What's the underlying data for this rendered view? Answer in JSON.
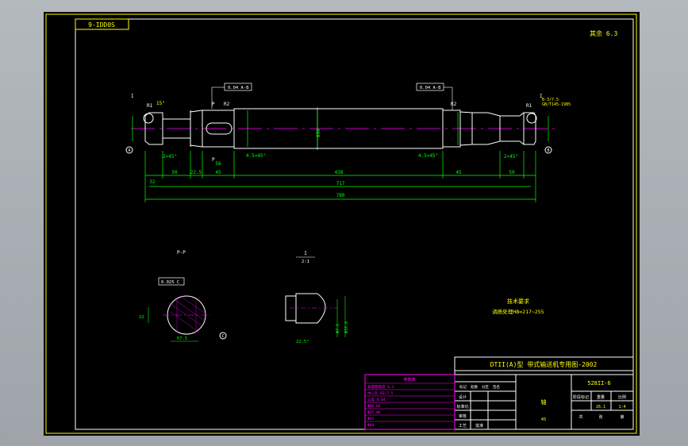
{
  "colors": {
    "background": "#000000",
    "frame": "#ffff00",
    "outline": "#ffffff",
    "dimension": "#00ff00",
    "centerline": "#ff00ff",
    "annotation": "#ffff00",
    "table": "#ff00ff"
  },
  "drawing_code_box": "9-IDD0S",
  "surface_finish_mark": "其余 6.3",
  "shaft": {
    "overall_length": "780",
    "length_717": "717",
    "length_438": "438",
    "left_segments": [
      "32",
      "50",
      "22.5",
      "45",
      "56"
    ],
    "right_segments": [
      "45",
      "50"
    ],
    "chamfer_left": "2×45°",
    "chamfer_mid_left": "4.5×45°",
    "chamfer_mid_right": "4.5×45°",
    "chamfer_right": "2×45°",
    "tolerance_left": "0.04 A-B",
    "tolerance_right": "0.04 A-B",
    "datum_a": "A",
    "datum_b": "B",
    "section_p_left": "P",
    "section_p_right": "P",
    "detail_label": "I",
    "radius_r1": "R1",
    "radius_r2": "R2",
    "center_hole_note": "B-3/7.5",
    "center_hole_std": "GB/T145-1985",
    "diameter_main": "Φ90",
    "angle_note": "15°"
  },
  "section_view": {
    "label": "P-P",
    "tolerance": "0.025 C",
    "key_width": "22",
    "dim_depth": "67.5",
    "datum_c": "C"
  },
  "detail_view": {
    "label_top": "I",
    "label_scale": "2:1",
    "angle": "22.5°",
    "dim_a": "Φ7.5",
    "dim_b": "Φ16.4"
  },
  "tech_requirements": {
    "title": "技术要求",
    "line1": "调质处理HB=217~255"
  },
  "title_block": {
    "series_title": "DTII(A)型 带式输送机专用图-2002",
    "drawing_number": "528II-6",
    "part_name": "轴",
    "material": "45",
    "scale": "1:4",
    "sheet": "1",
    "weight": "26.1",
    "stage_label": "阶段标记",
    "weight_label": "重量",
    "scale_label": "比例",
    "row_labels": [
      "标记",
      "处数",
      "分区",
      "更改文件号",
      "签名",
      "年月日"
    ],
    "role_labels": [
      "设计",
      "标准化",
      "审核",
      "工艺",
      "批准"
    ],
    "share_label": "共",
    "sheet_label": "第",
    "unit_label": "张"
  },
  "param_table": {
    "title": "参数表",
    "rows": [
      "表面粗糙度 6.3",
      "中心孔 B3/7.5",
      "公差 0.04",
      "Φ90 k6",
      "Φ75 m6",
      "Φ65",
      "Φ60"
    ]
  }
}
